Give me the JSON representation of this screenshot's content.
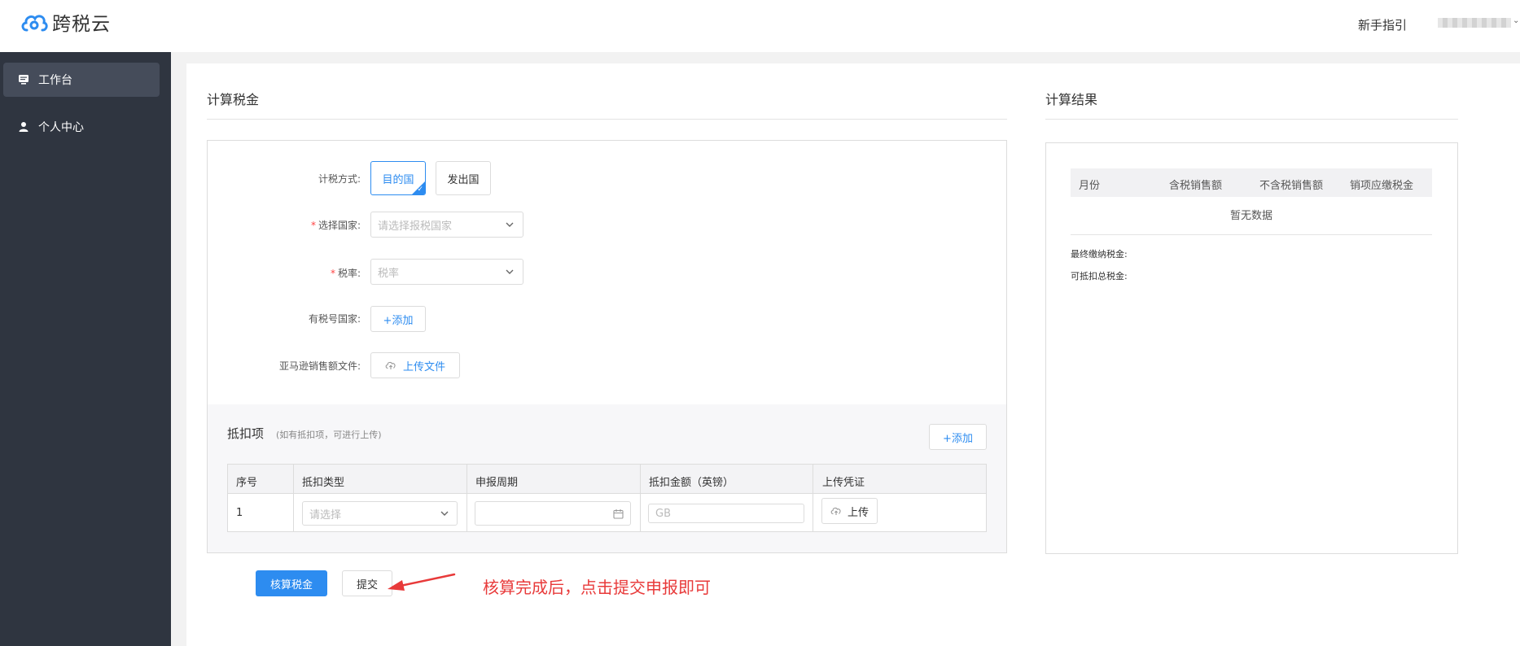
{
  "brand": {
    "name": "跨税云",
    "accent": "#2d8cf0"
  },
  "header": {
    "guide": "新手指引"
  },
  "sidebar": {
    "items": [
      {
        "label": "工作台",
        "icon": "monitor-icon",
        "active": true
      },
      {
        "label": "个人中心",
        "icon": "user-icon",
        "active": false
      }
    ]
  },
  "calc": {
    "title": "计算税金",
    "method_label": "计税方式:",
    "method_options": [
      "目的国",
      "发出国"
    ],
    "country_label": "选择国家:",
    "country_placeholder": "请选择报税国家",
    "rate_label": "税率:",
    "rate_placeholder": "税率",
    "taxno_label": "有税号国家:",
    "taxno_add": "+添加",
    "upload_label": "亚马逊销售额文件:",
    "upload_btn": "上传文件",
    "required_mark": "*"
  },
  "deduct": {
    "title": "抵扣项",
    "hint": "(如有抵扣项，可进行上传)",
    "add": "+添加",
    "headers": [
      "序号",
      "抵扣类型",
      "申报周期",
      "抵扣金额（英镑）",
      "上传凭证"
    ],
    "rows": [
      {
        "index": "1",
        "type_placeholder": "请选择",
        "amount_placeholder": "GB",
        "upload": "上传"
      }
    ]
  },
  "actions": {
    "calculate": "核算税金",
    "submit": "提交",
    "annotation": "核算完成后，点击提交申报即可"
  },
  "result": {
    "title": "计算结果",
    "headers": [
      "月份",
      "含税销售额",
      "不含税销售额",
      "销项应缴税金"
    ],
    "empty": "暂无数据",
    "final_tax": "最终缴纳税金:",
    "deductible_tax": "可抵扣总税金:"
  }
}
